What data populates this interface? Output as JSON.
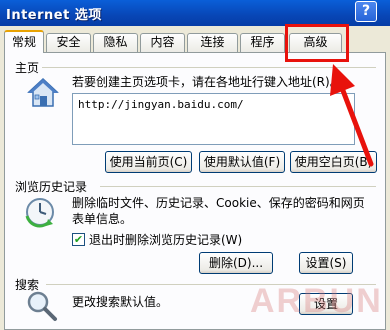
{
  "window": {
    "title": "Internet 选项",
    "help_label": "?"
  },
  "tabs": [
    {
      "label": "常规"
    },
    {
      "label": "安全"
    },
    {
      "label": "隐私"
    },
    {
      "label": "内容"
    },
    {
      "label": "连接"
    },
    {
      "label": "程序"
    },
    {
      "label": "高级"
    }
  ],
  "homepage": {
    "title": "主页",
    "description": "若要创建主页选项卡，请在各地址行键入地址(R)。",
    "url": "http://jingyan.baidu.com/",
    "buttons": {
      "use_current": "使用当前页(C)",
      "use_default": "使用默认值(F)",
      "use_blank": "使用空白页(B)"
    }
  },
  "history": {
    "title": "浏览历史记录",
    "description_line1": "删除临时文件、历史记录、Cookie、保存的密码和网页",
    "description_line2": "表单信息。",
    "checkbox_label": "退出时删除浏览历史记录(W)",
    "checkbox_checked": true,
    "delete_button": "删除(D)...",
    "settings_button": "设置(S)"
  },
  "search": {
    "title": "搜索",
    "description": "更改搜索默认值。",
    "settings_button": "设置"
  },
  "watermark_text": "ARBUN",
  "annotation_color": "#e8120c"
}
